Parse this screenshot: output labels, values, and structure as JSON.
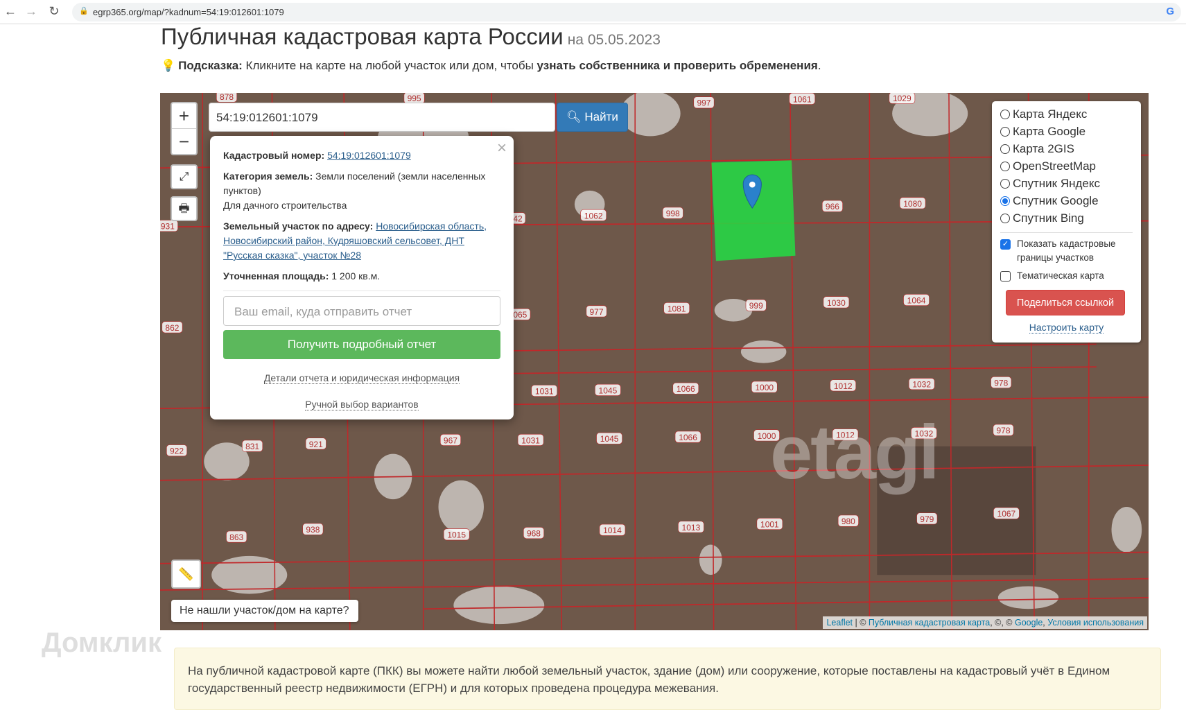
{
  "browser": {
    "url": "egrp365.org/map/?kadnum=54:19:012601:1079",
    "back_icon": "arrow-left-icon",
    "forward_icon": "arrow-right-icon",
    "reload_icon": "reload-icon",
    "lock_icon": "lock-icon",
    "google_icon": "G"
  },
  "header": {
    "title": "Публичная кадастровая карта России",
    "date": "на 05.05.2023",
    "hint_label": "Подсказка:",
    "hint_text": " Кликните на карте на любой участок или дом, чтобы ",
    "hint_bold": "узнать собственника и проверить обременения",
    "hint_end": "."
  },
  "map": {
    "zoom_in": "+",
    "zoom_out": "−",
    "fullscreen_icon": "⤢",
    "print_icon": "🖶",
    "ruler_icon": "📏",
    "search_value": "54:19:012601:1079",
    "find_label": "Найти",
    "find_icon": "search-icon",
    "not_found": "Не нашли участок/дом на карте?",
    "parcel_color": "#22dd44",
    "boundary_color": "#c0282a",
    "parcel_labels": [
      "878",
      "995",
      "997",
      "1061",
      "1029",
      "1062",
      "998",
      "966",
      "1080",
      "931",
      "42",
      "862",
      "065",
      "977",
      "1081",
      "999",
      "1030",
      "1064",
      "1031",
      "1045",
      "1066",
      "1000",
      "1012",
      "1032",
      "978",
      "922",
      "831",
      "921",
      "967",
      "1031",
      "1045",
      "1066",
      "1000",
      "1012",
      "1032",
      "978",
      "863",
      "938",
      "1015",
      "968",
      "1014",
      "1013",
      "1001",
      "980",
      "979",
      "1067"
    ],
    "watermark": "etagi",
    "attribution": {
      "leaflet": "Leaflet",
      "sep": " | © ",
      "pkk": "Публичная кадастровая карта",
      "mid": ", ©, © ",
      "google": "Google",
      "sep2": ", ",
      "terms": "Условия использования"
    }
  },
  "popup": {
    "cadnum_label": "Кадастровый номер:",
    "cadnum": "54:19:012601:1079",
    "category_label": "Категория земель:",
    "category": "Земли поселений (земли населенных пунктов)",
    "use": "Для дачного строительства",
    "address_label": "Земельный участок по адресу:",
    "address": "Новосибирская область, Новосибирский район, Кудряшовский сельсовет, ДНТ \"Русская сказка\", участок №28",
    "area_label": "Уточненная площадь:",
    "area": "1 200 кв.м.",
    "email_placeholder": "Ваш email, куда отправить отчет",
    "report_button": "Получить подробный отчет",
    "details_link": "Детали отчета и юридическая информация",
    "manual_link": "Ручной выбор вариантов",
    "close": "×"
  },
  "layers": {
    "options": [
      {
        "label": "Карта Яндекс",
        "selected": false
      },
      {
        "label": "Карта Google",
        "selected": false
      },
      {
        "label": "Карта 2GIS",
        "selected": false
      },
      {
        "label": "OpenStreetMap",
        "selected": false
      },
      {
        "label": "Спутник Яндекс",
        "selected": false
      },
      {
        "label": "Спутник Google",
        "selected": true
      },
      {
        "label": "Спутник Bing",
        "selected": false
      }
    ],
    "show_boundaries": "Показать кадастровые границы участков",
    "show_boundaries_checked": true,
    "thematic": "Тематическая карта",
    "thematic_checked": false,
    "share_button": "Поделиться ссылкой",
    "setup_link": "Настроить карту"
  },
  "info": {
    "text": "На публичной кадастровой карте (ПКК) вы можете найти любой земельный участок, здание (дом) или сооружение, которые поставлены на кадастровый учёт в Едином государственный реестр недвижимости (ЕГРН) и для которых проведена процедура межевания."
  },
  "domclick_watermark": "Домклик"
}
